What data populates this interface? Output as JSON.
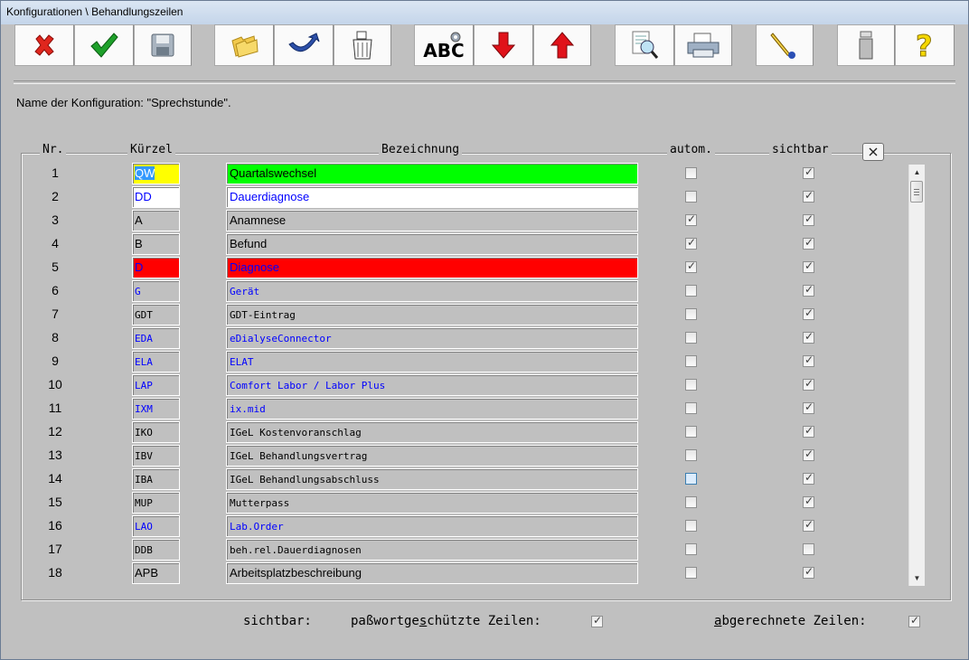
{
  "window": {
    "title": "Konfigurationen \\ Behandlungszeilen"
  },
  "toolbar": [
    {
      "name": "cancel-button",
      "icon": "red-x-icon"
    },
    {
      "name": "ok-button",
      "icon": "green-checkmark-icon"
    },
    {
      "name": "save-button",
      "icon": "floppy-disk-icon"
    },
    {
      "name": "open-button",
      "icon": "folders-icon"
    },
    {
      "name": "undo-button",
      "icon": "curved-arrow-icon"
    },
    {
      "name": "delete-button",
      "icon": "trash-can-icon"
    },
    {
      "name": "spellcheck-button",
      "icon": "abc-gear-icon",
      "label": "ABC"
    },
    {
      "name": "move-down-button",
      "icon": "red-arrow-down-icon"
    },
    {
      "name": "move-up-button",
      "icon": "red-arrow-up-icon"
    },
    {
      "name": "preview-button",
      "icon": "magnifier-icon"
    },
    {
      "name": "print-button",
      "icon": "printer-icon"
    },
    {
      "name": "edit-button",
      "icon": "pen-hand-icon"
    },
    {
      "name": "info-button",
      "icon": "info-icon"
    },
    {
      "name": "help-button",
      "icon": "question-icon"
    }
  ],
  "config_name": "Name der Konfiguration: \"Sprechstunde\".",
  "columns": {
    "nr": "Nr.",
    "kuerzel": "Kürzel",
    "bezeichnung": "Bezeichnung",
    "autom": "autom.",
    "sichtbar": "sichtbar"
  },
  "rows": [
    {
      "nr": "1",
      "kuerzel": "QW",
      "bezeichnung": "Quartalswechsel",
      "autom": false,
      "sichtbar": true,
      "bg_k": "#ffff00",
      "bg_b": "#00ff00",
      "color": "#000000",
      "mono": false,
      "selected": true
    },
    {
      "nr": "2",
      "kuerzel": "DD",
      "bezeichnung": "Dauerdiagnose",
      "autom": false,
      "sichtbar": true,
      "bg_k": "#ffffff",
      "bg_b": "#ffffff",
      "color": "#0000ff",
      "mono": false
    },
    {
      "nr": "3",
      "kuerzel": "A",
      "bezeichnung": "Anamnese",
      "autom": true,
      "sichtbar": true,
      "bg_k": "#c0c0c0",
      "bg_b": "#c0c0c0",
      "color": "#000000",
      "mono": false
    },
    {
      "nr": "4",
      "kuerzel": "B",
      "bezeichnung": "Befund",
      "autom": true,
      "sichtbar": true,
      "bg_k": "#c0c0c0",
      "bg_b": "#c0c0c0",
      "color": "#000000",
      "mono": false
    },
    {
      "nr": "5",
      "kuerzel": "D",
      "bezeichnung": "Diagnose",
      "autom": true,
      "sichtbar": true,
      "bg_k": "#ff0000",
      "bg_b": "#ff0000",
      "color": "#0000ff",
      "mono": false
    },
    {
      "nr": "6",
      "kuerzel": "G",
      "bezeichnung": "Gerät",
      "autom": false,
      "sichtbar": true,
      "bg_k": "#c0c0c0",
      "bg_b": "#c0c0c0",
      "color": "#0000ff",
      "mono": true
    },
    {
      "nr": "7",
      "kuerzel": "GDT",
      "bezeichnung": "GDT-Eintrag",
      "autom": false,
      "sichtbar": true,
      "bg_k": "#c0c0c0",
      "bg_b": "#c0c0c0",
      "color": "#000000",
      "mono": true
    },
    {
      "nr": "8",
      "kuerzel": "EDA",
      "bezeichnung": "eDialyseConnector",
      "autom": false,
      "sichtbar": true,
      "bg_k": "#c0c0c0",
      "bg_b": "#c0c0c0",
      "color": "#0000ff",
      "mono": true
    },
    {
      "nr": "9",
      "kuerzel": "ELA",
      "bezeichnung": "ELAT",
      "autom": false,
      "sichtbar": true,
      "bg_k": "#c0c0c0",
      "bg_b": "#c0c0c0",
      "color": "#0000ff",
      "mono": true
    },
    {
      "nr": "10",
      "kuerzel": "LAP",
      "bezeichnung": "Comfort Labor / Labor Plus",
      "autom": false,
      "sichtbar": true,
      "bg_k": "#c0c0c0",
      "bg_b": "#c0c0c0",
      "color": "#0000ff",
      "mono": true
    },
    {
      "nr": "11",
      "kuerzel": "IXM",
      "bezeichnung": "ix.mid",
      "autom": false,
      "sichtbar": true,
      "bg_k": "#c0c0c0",
      "bg_b": "#c0c0c0",
      "color": "#0000ff",
      "mono": true
    },
    {
      "nr": "12",
      "kuerzel": "IKO",
      "bezeichnung": "IGeL Kostenvoranschlag",
      "autom": false,
      "sichtbar": true,
      "bg_k": "#c0c0c0",
      "bg_b": "#c0c0c0",
      "color": "#000000",
      "mono": true
    },
    {
      "nr": "13",
      "kuerzel": "IBV",
      "bezeichnung": "IGeL Behandlungsvertrag",
      "autom": false,
      "sichtbar": true,
      "bg_k": "#c0c0c0",
      "bg_b": "#c0c0c0",
      "color": "#000000",
      "mono": true
    },
    {
      "nr": "14",
      "kuerzel": "IBA",
      "bezeichnung": "IGeL Behandlungsabschluss",
      "autom": false,
      "sichtbar": true,
      "bg_k": "#c0c0c0",
      "bg_b": "#c0c0c0",
      "color": "#000000",
      "mono": true,
      "hover": true
    },
    {
      "nr": "15",
      "kuerzel": "MUP",
      "bezeichnung": "Mutterpass",
      "autom": false,
      "sichtbar": true,
      "bg_k": "#c0c0c0",
      "bg_b": "#c0c0c0",
      "color": "#000000",
      "mono": true
    },
    {
      "nr": "16",
      "kuerzel": "LAO",
      "bezeichnung": "Lab.Order",
      "autom": false,
      "sichtbar": true,
      "bg_k": "#c0c0c0",
      "bg_b": "#c0c0c0",
      "color": "#0000ff",
      "mono": true
    },
    {
      "nr": "17",
      "kuerzel": "DDB",
      "bezeichnung": "beh.rel.Dauerdiagnosen",
      "autom": false,
      "sichtbar": false,
      "bg_k": "#c0c0c0",
      "bg_b": "#c0c0c0",
      "color": "#000000",
      "mono": true
    },
    {
      "nr": "18",
      "kuerzel": "APB",
      "bezeichnung": "Arbeitsplatzbeschreibung",
      "autom": false,
      "sichtbar": true,
      "bg_k": "#c0c0c0",
      "bg_b": "#c0c0c0",
      "color": "#000000",
      "mono": false
    }
  ],
  "footer": {
    "sichtbar_label": "sichtbar:",
    "pw_label_pre": "paßwortge",
    "pw_label_u": "s",
    "pw_label_post": "chützte Zeilen:",
    "pw_checked": true,
    "ab_label_u": "a",
    "ab_label_post": "bgerechnete Zeilen:",
    "ab_checked": true
  },
  "colors": {
    "background": "#c0c0c0",
    "accent_blue": "#0000ff",
    "highlight_green": "#00ff00",
    "highlight_red": "#ff0000",
    "highlight_yellow": "#ffff00"
  }
}
